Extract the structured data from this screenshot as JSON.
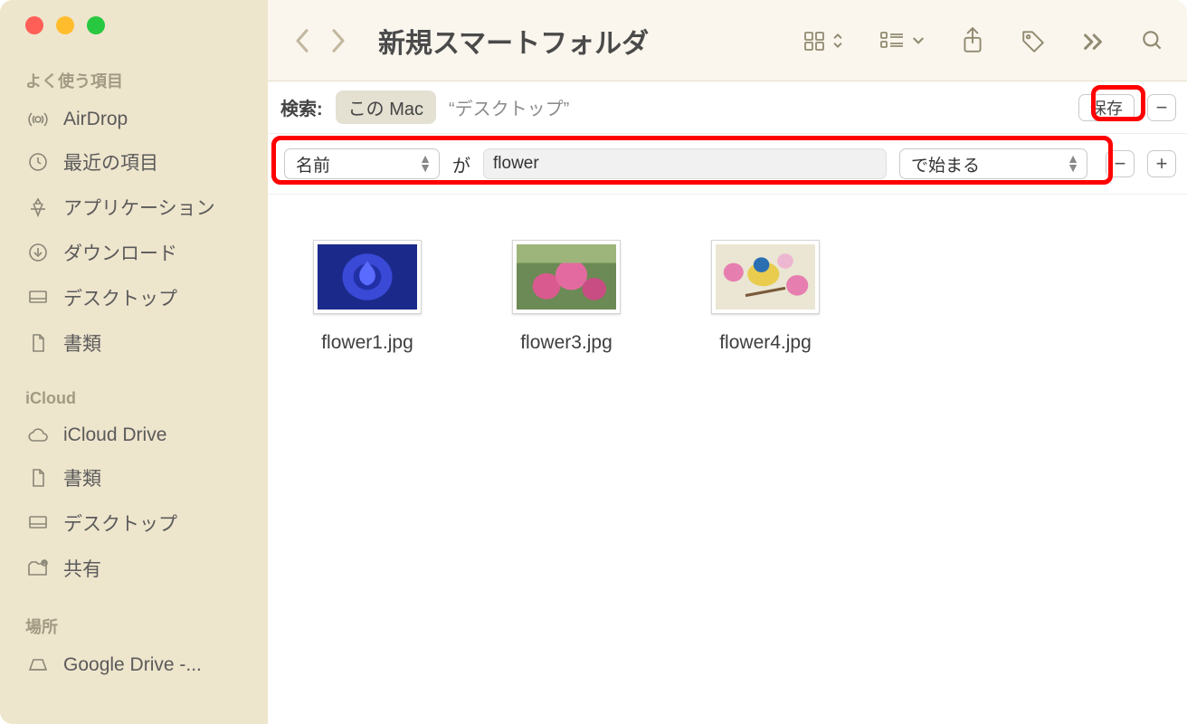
{
  "toolbar": {
    "title": "新規スマートフォルダ"
  },
  "sidebar": {
    "section_favorites": "よく使う項目",
    "section_icloud": "iCloud",
    "section_locations": "場所",
    "favorites": [
      {
        "icon": "airdrop",
        "label": "AirDrop"
      },
      {
        "icon": "clock",
        "label": "最近の項目"
      },
      {
        "icon": "apps",
        "label": "アプリケーション"
      },
      {
        "icon": "download",
        "label": "ダウンロード"
      },
      {
        "icon": "desktop",
        "label": "デスクトップ"
      },
      {
        "icon": "doc",
        "label": "書類"
      }
    ],
    "icloud": [
      {
        "icon": "cloud",
        "label": "iCloud Drive"
      },
      {
        "icon": "doc",
        "label": "書類"
      },
      {
        "icon": "desktop",
        "label": "デスクトップ"
      },
      {
        "icon": "shared",
        "label": "共有"
      }
    ],
    "locations": [
      {
        "icon": "disk",
        "label": "Google Drive -..."
      }
    ]
  },
  "scope": {
    "label": "検索:",
    "active": "この Mac",
    "alt": "“デスクトップ”",
    "save": "保存"
  },
  "criteria": {
    "attribute": "名前",
    "verb": "が",
    "value": "flower",
    "operator": "で始まる"
  },
  "files": [
    {
      "name": "flower1.jpg",
      "thumb": "blue-rose"
    },
    {
      "name": "flower3.jpg",
      "thumb": "pink-roses"
    },
    {
      "name": "flower4.jpg",
      "thumb": "bird-blossom"
    }
  ]
}
